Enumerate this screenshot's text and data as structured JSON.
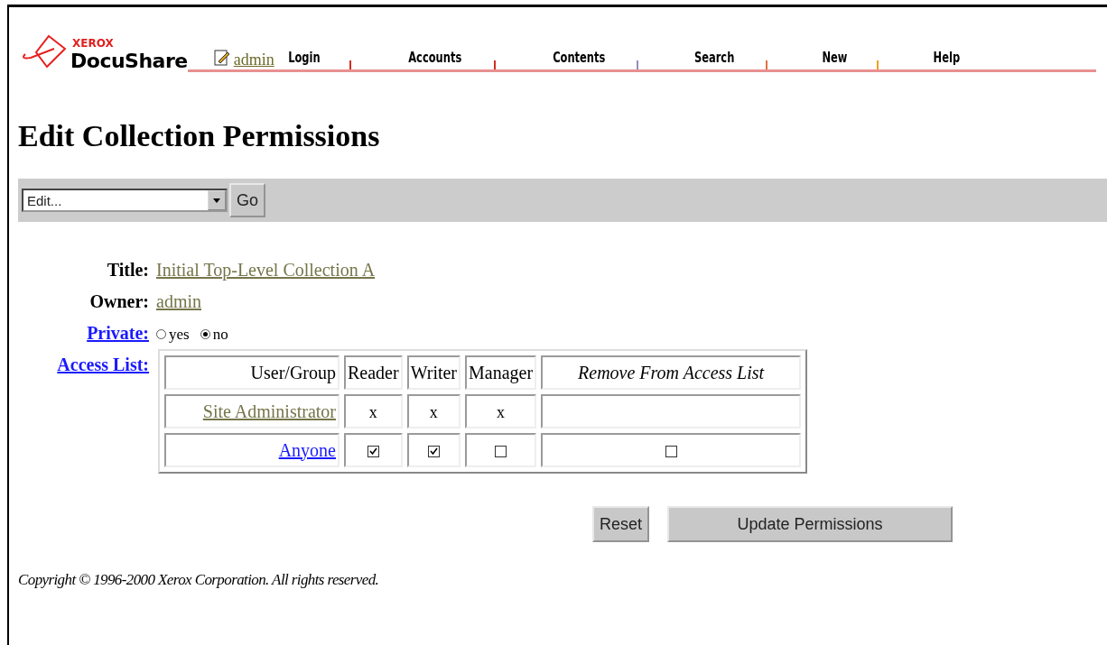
{
  "header": {
    "logo": {
      "brand": "XEROX",
      "product": "DocuShare"
    },
    "user": "admin",
    "nav": [
      "Login",
      "Accounts",
      "Contents",
      "Search",
      "New",
      "Help"
    ]
  },
  "heading": "Edit Collection Permissions",
  "toolbar": {
    "select": {
      "value": "Edit..."
    },
    "go": "Go"
  },
  "fields": {
    "title": {
      "label": "Title:",
      "value": "Initial Top-Level Collection A"
    },
    "owner": {
      "label": "Owner:",
      "value": "admin"
    },
    "private": {
      "label": "Private:",
      "options": [
        {
          "label": "yes",
          "selected": false
        },
        {
          "label": "no",
          "selected": true
        }
      ]
    },
    "access_list": {
      "label": "Access List:"
    }
  },
  "table": {
    "columns": [
      {
        "label": "User/Group",
        "italic": false
      },
      {
        "label": "Reader",
        "italic": false
      },
      {
        "label": "Writer",
        "italic": false
      },
      {
        "label": "Manager",
        "italic": false
      },
      {
        "label": "Remove From Access List",
        "italic": true
      }
    ],
    "rows": [
      {
        "cells": [
          {
            "kind": "link",
            "text": "Site Administrator",
            "visited": true
          },
          {
            "kind": "mark",
            "text": "x"
          },
          {
            "kind": "mark",
            "text": "x"
          },
          {
            "kind": "mark",
            "text": "x"
          },
          {
            "kind": "empty"
          }
        ]
      },
      {
        "cells": [
          {
            "kind": "link",
            "text": "Anyone",
            "visited": false
          },
          {
            "kind": "checkbox",
            "checked": true
          },
          {
            "kind": "checkbox",
            "checked": true
          },
          {
            "kind": "checkbox",
            "checked": false
          },
          {
            "kind": "checkbox",
            "checked": false
          }
        ]
      }
    ]
  },
  "buttons": [
    "Reset",
    "Update Permissions"
  ],
  "copyright": "Copyright © 1996-2000 Xerox Corporation. All rights reserved."
}
